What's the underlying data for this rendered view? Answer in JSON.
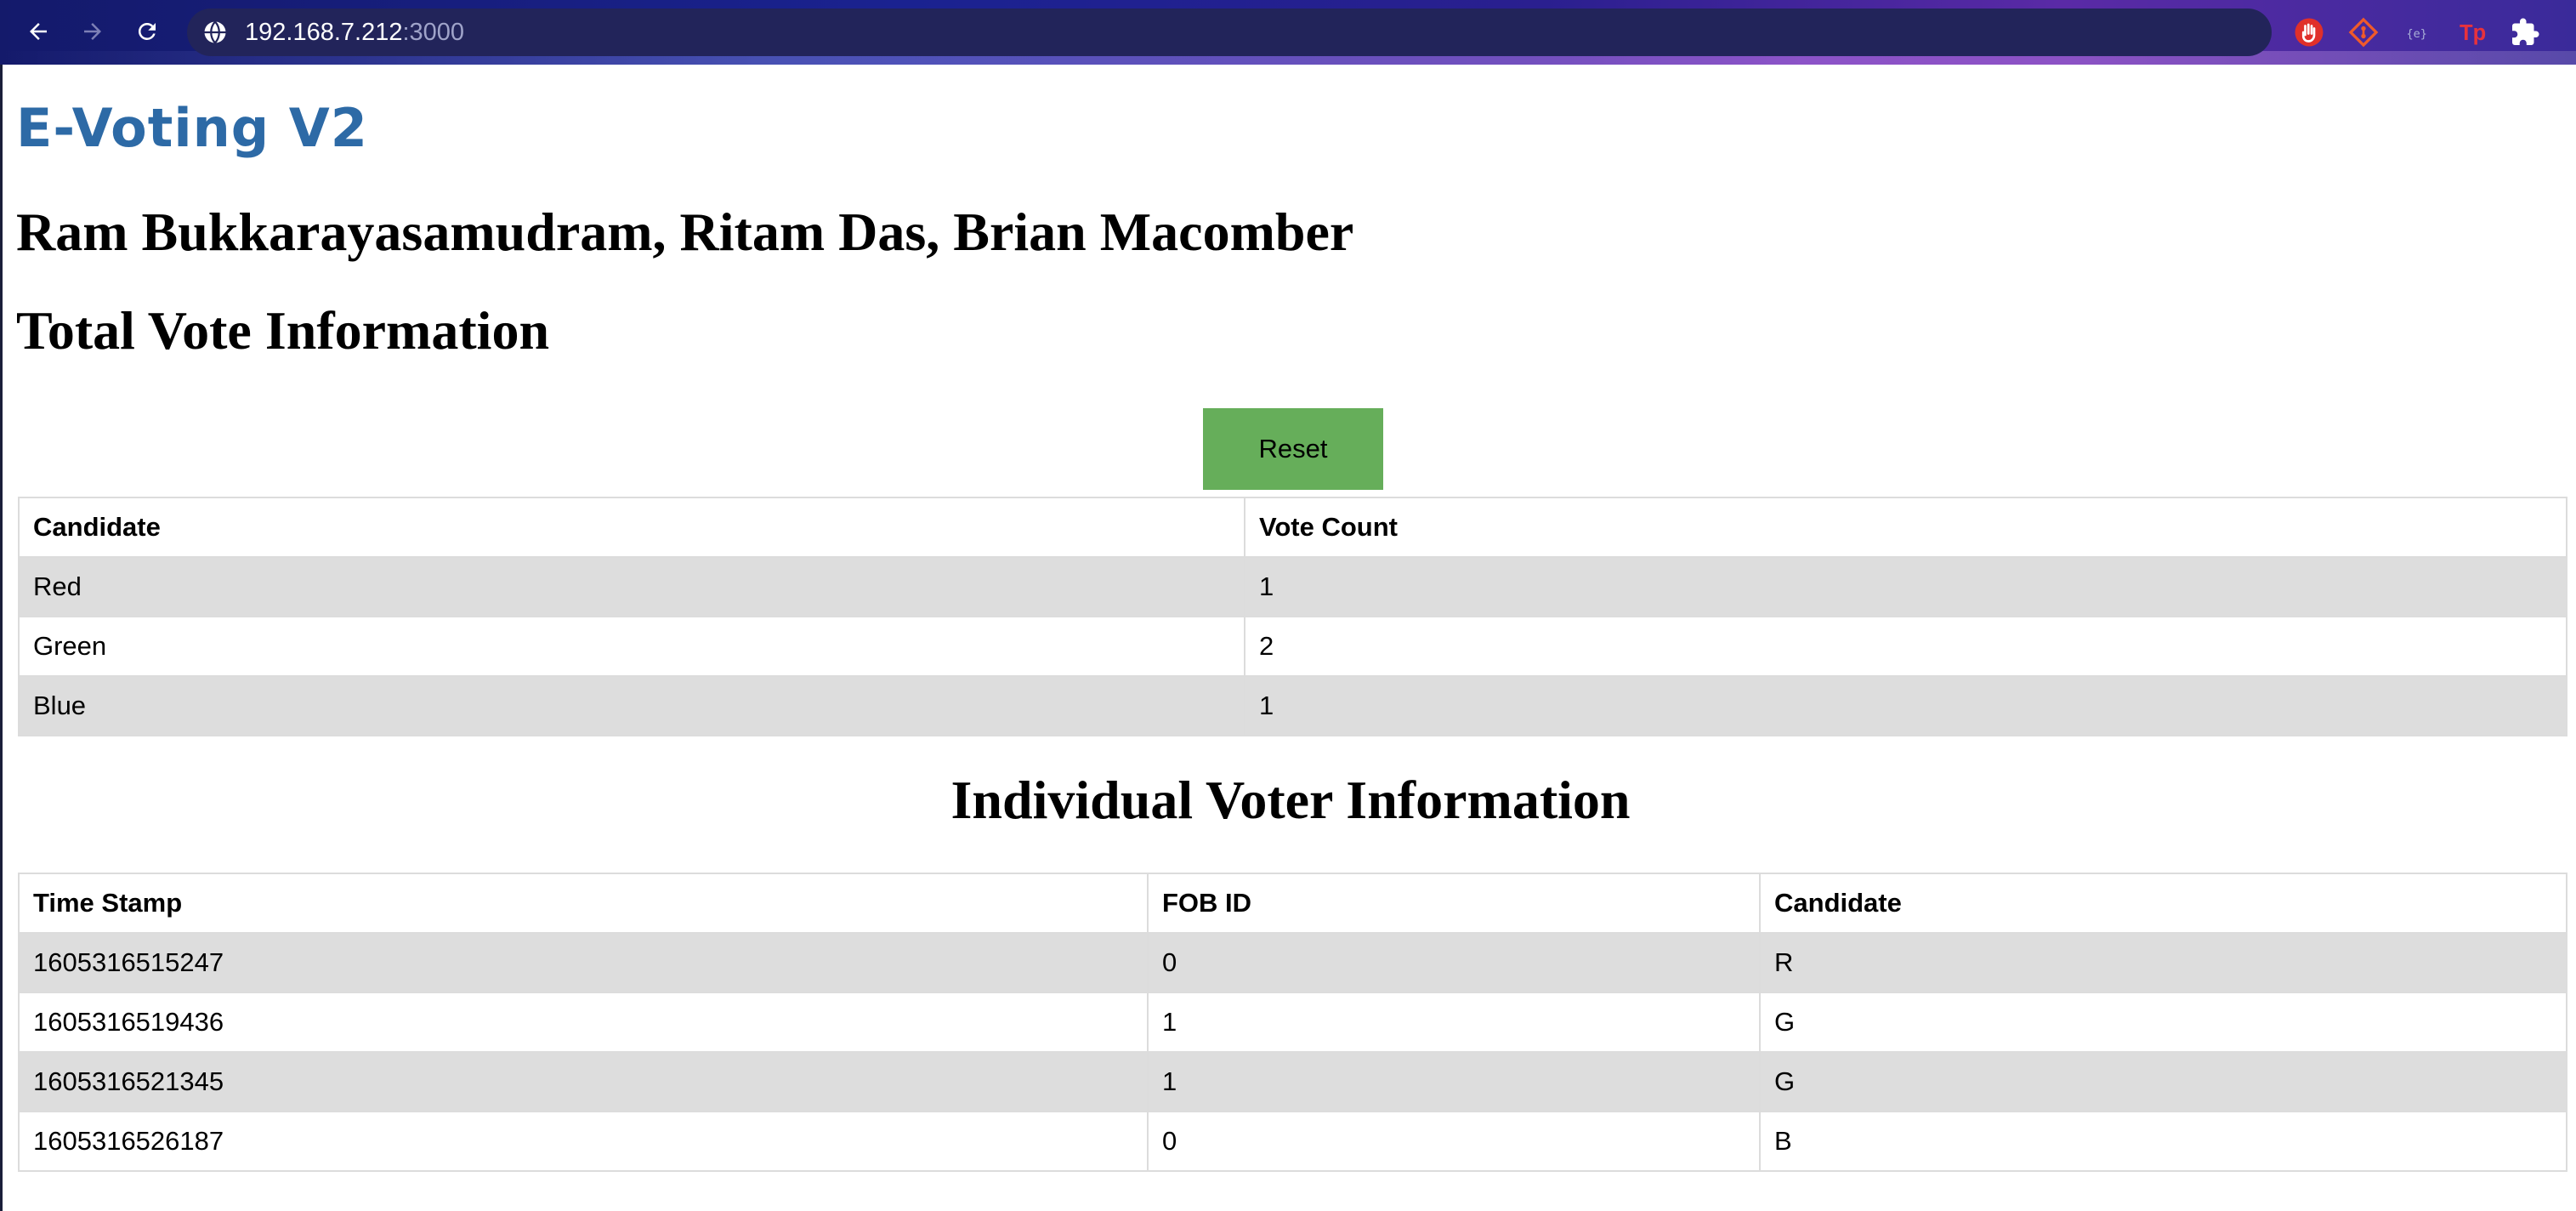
{
  "browser": {
    "url_host": "192.168.7.212",
    "url_port": ":3000"
  },
  "page": {
    "app_title": "E-Voting V2",
    "authors": "Ram Bukkarayasamudram, Ritam Das, Brian Macomber",
    "total_heading": "Total Vote Information",
    "reset_label": "Reset",
    "individual_heading": "Individual Voter Information"
  },
  "totals_table": {
    "headers": [
      "Candidate",
      "Vote Count"
    ],
    "rows": [
      [
        "Red",
        "1"
      ],
      [
        "Green",
        "2"
      ],
      [
        "Blue",
        "1"
      ]
    ]
  },
  "voters_table": {
    "headers": [
      "Time Stamp",
      "FOB ID",
      "Candidate"
    ],
    "rows": [
      [
        "1605316515247",
        "0",
        "R"
      ],
      [
        "1605316519436",
        "1",
        "G"
      ],
      [
        "1605316521345",
        "1",
        "G"
      ],
      [
        "1605316526187",
        "0",
        "B"
      ]
    ]
  },
  "icons": {
    "back": "arrow-left-icon",
    "forward": "arrow-right-icon",
    "reload": "reload-icon",
    "site_info": "site-info-icon",
    "extensions": [
      "hand-extension-icon",
      "git-extension-icon",
      "json-extension-icon",
      "tp-extension-icon",
      "puzzle-extensions-icon"
    ]
  },
  "colors": {
    "title_blue": "#2d6aa6",
    "reset_green": "#66ae5a",
    "stripe_gray": "#dddddd"
  }
}
